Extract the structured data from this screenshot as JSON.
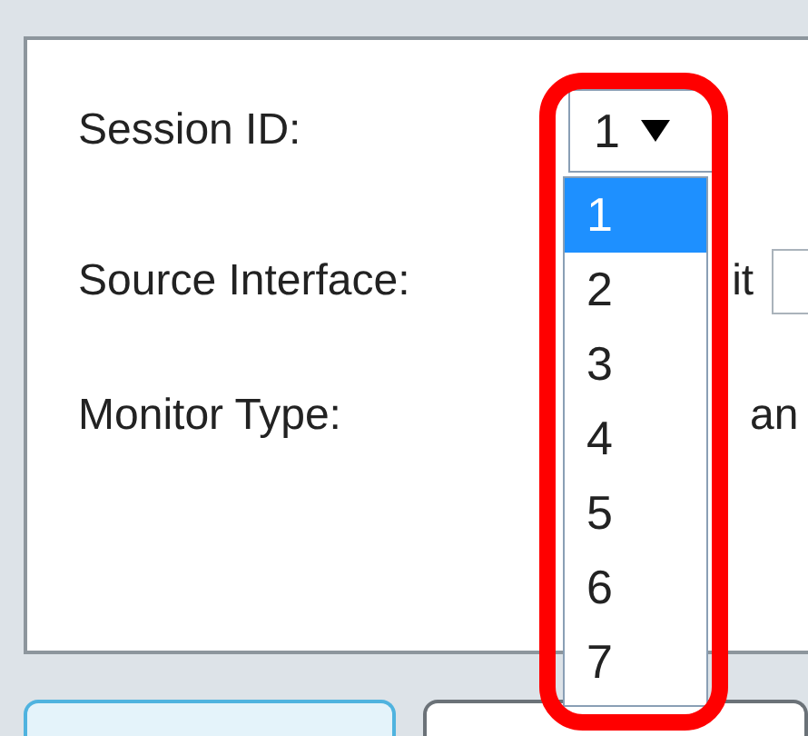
{
  "fields": [
    {
      "label": "Session ID:",
      "kind": "select",
      "value": "1"
    },
    {
      "label": "Source Interface:",
      "kind": "covered",
      "value": "it"
    },
    {
      "label": "Monitor Type:",
      "kind": "covered",
      "value": "an"
    }
  ],
  "dropdown": {
    "options": [
      {
        "label": "1",
        "selected": true
      },
      {
        "label": "2",
        "selected": false
      },
      {
        "label": "3",
        "selected": false
      },
      {
        "label": "4",
        "selected": false
      },
      {
        "label": "5",
        "selected": false
      },
      {
        "label": "6",
        "selected": false
      },
      {
        "label": "7",
        "selected": false
      }
    ]
  }
}
